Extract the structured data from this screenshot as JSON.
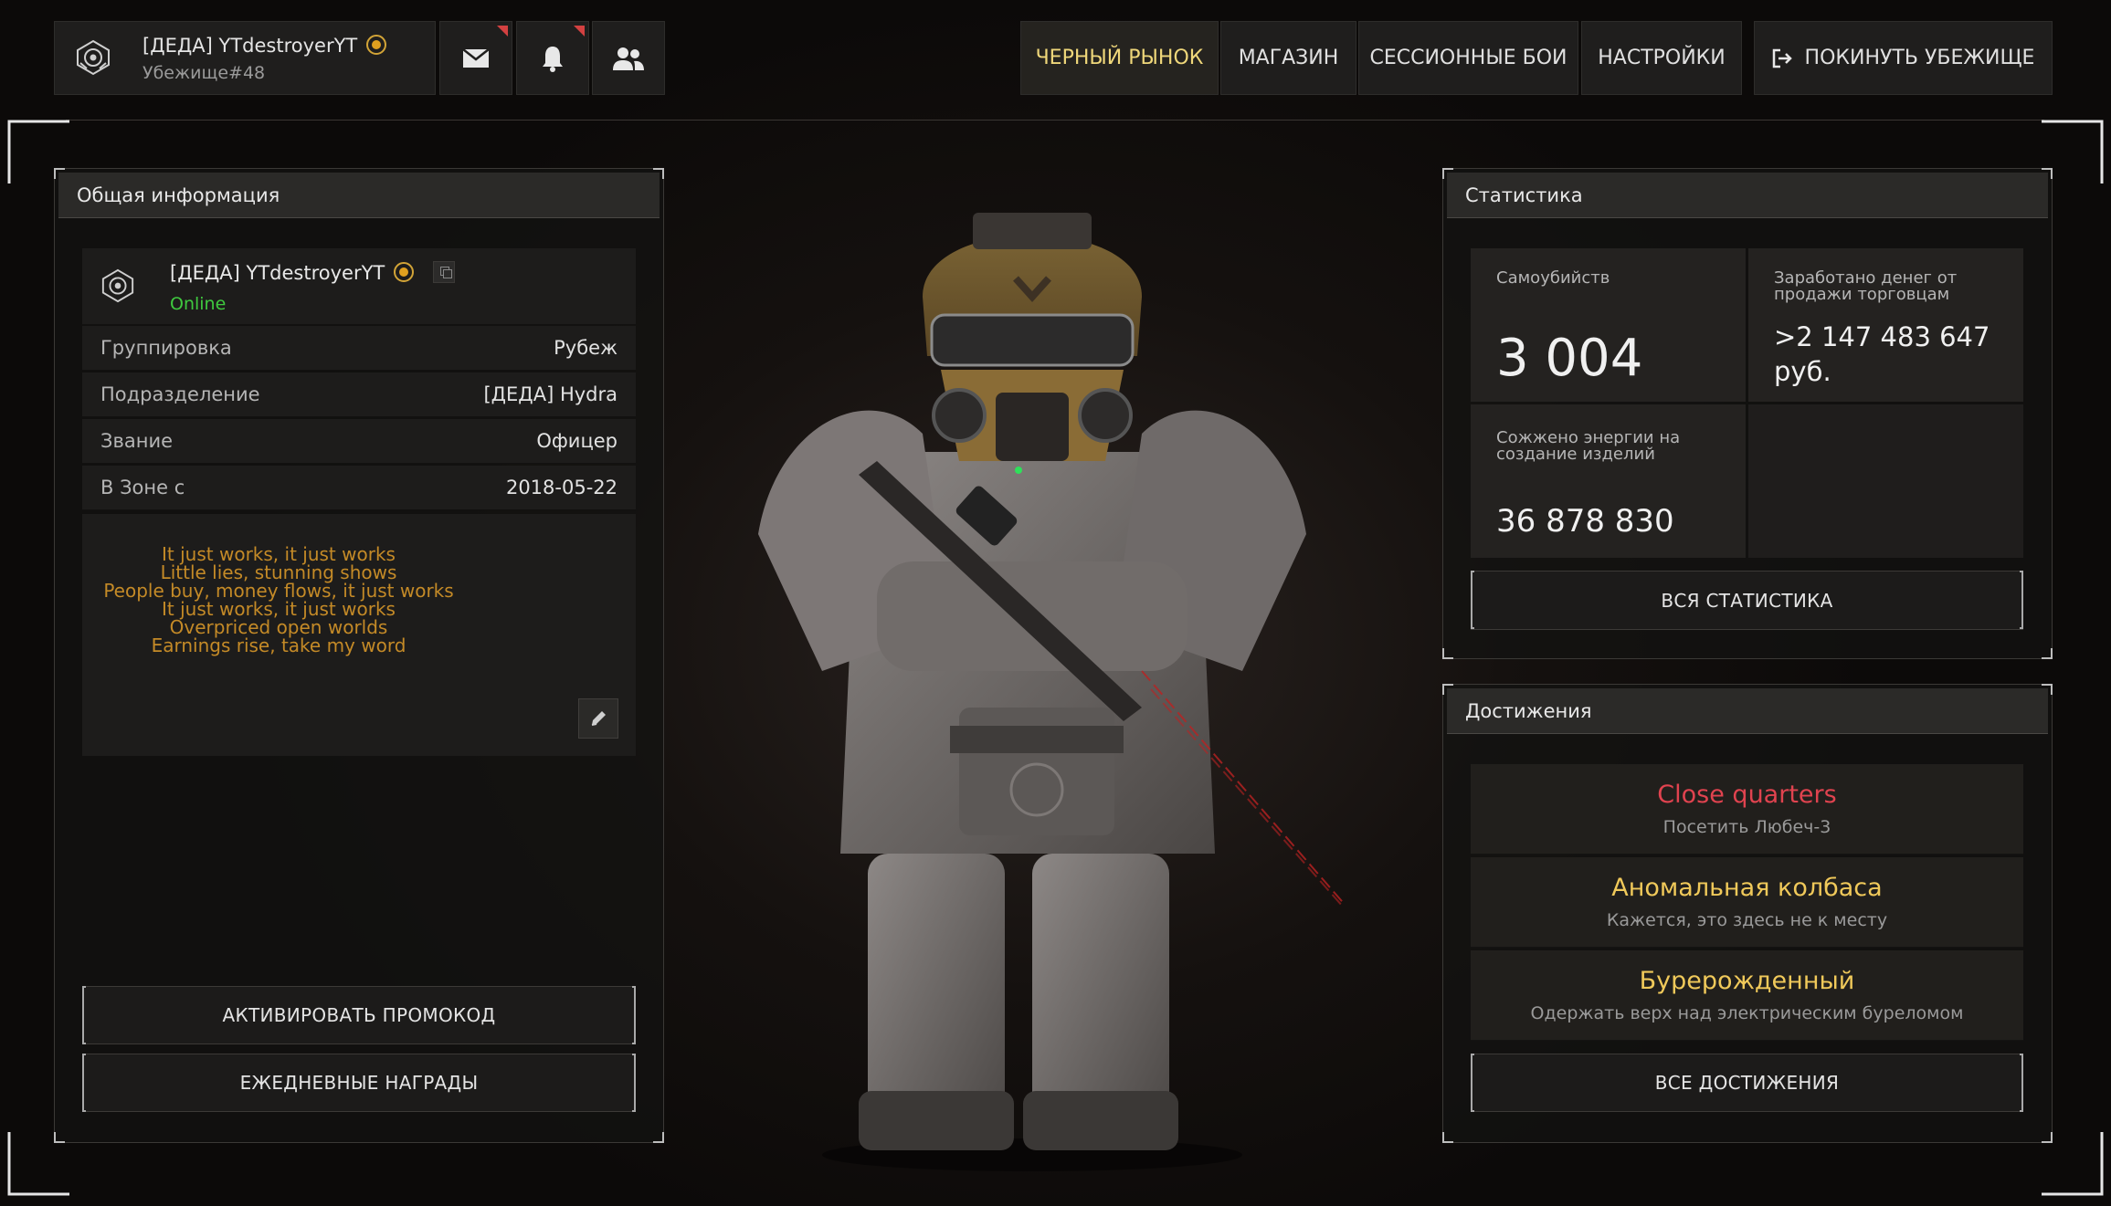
{
  "header": {
    "player_name": "[ДЕДА] YTdestroyerYT",
    "shelter": "Убежище#48",
    "nav": {
      "black_market": "ЧЕРНЫЙ РЫНОК",
      "shop": "МАГАЗИН",
      "session_battles": "СЕССИОННЫЕ БОИ",
      "settings": "НАСТРОЙКИ",
      "leave": "ПОКИНУТЬ УБЕЖИЩЕ"
    },
    "icons": [
      "mail-icon",
      "bell-icon",
      "friends-icon",
      "logout-icon"
    ]
  },
  "general": {
    "title": "Общая информация",
    "player_name": "[ДЕДА] YTdestroyerYT",
    "status": "Online",
    "rows": [
      {
        "key": "Группировка",
        "value": "Рубеж"
      },
      {
        "key": "Подразделение",
        "value": "[ДЕДА] Hydra"
      },
      {
        "key": "Звание",
        "value": "Офицер"
      },
      {
        "key": "В Зоне с",
        "value": "2018-05-22"
      }
    ],
    "bio": [
      "It just works, it just works",
      "Little lies, stunning shows",
      "People buy, money flows, it just works",
      "It just works, it just works",
      "Overpriced open worlds",
      "Earnings rise, take my word"
    ],
    "promo_button": "АКТИВИРОВАТЬ ПРОМОКОД",
    "daily_button": "ЕЖЕДНЕВНЫЕ НАГРАДЫ"
  },
  "stats": {
    "title": "Статистика",
    "suicides_label": "Самоубийств",
    "suicides_value": "3 004",
    "money_label_1": "Заработано денег от",
    "money_label_2": "продажи торговцам",
    "money_value_1": ">2 147 483 647",
    "money_value_2": "руб.",
    "energy_label_1": "Сожжено энергии на",
    "energy_label_2": "создание изделий",
    "energy_value": "36 878 830",
    "all_button": "ВСЯ СТАТИСТИКА"
  },
  "achievements": {
    "title": "Достижения",
    "items": [
      {
        "title": "Close quarters",
        "desc": "Посетить Любеч-3",
        "color": "#e0434f"
      },
      {
        "title": "Аномальная колбаса",
        "desc": "Кажется, это здесь не к месту",
        "color": "#f0c95a"
      },
      {
        "title": "Бурерожденный",
        "desc": "Одержать верх над электрическим буреломом",
        "color": "#f0c95a"
      }
    ],
    "all_button": "ВСЕ ДОСТИЖЕНИЯ"
  },
  "colors": {
    "accent_gold": "#efd77a",
    "online_green": "#3fc93f",
    "bio_orange": "#c48a27",
    "notification_red": "#d34141"
  }
}
